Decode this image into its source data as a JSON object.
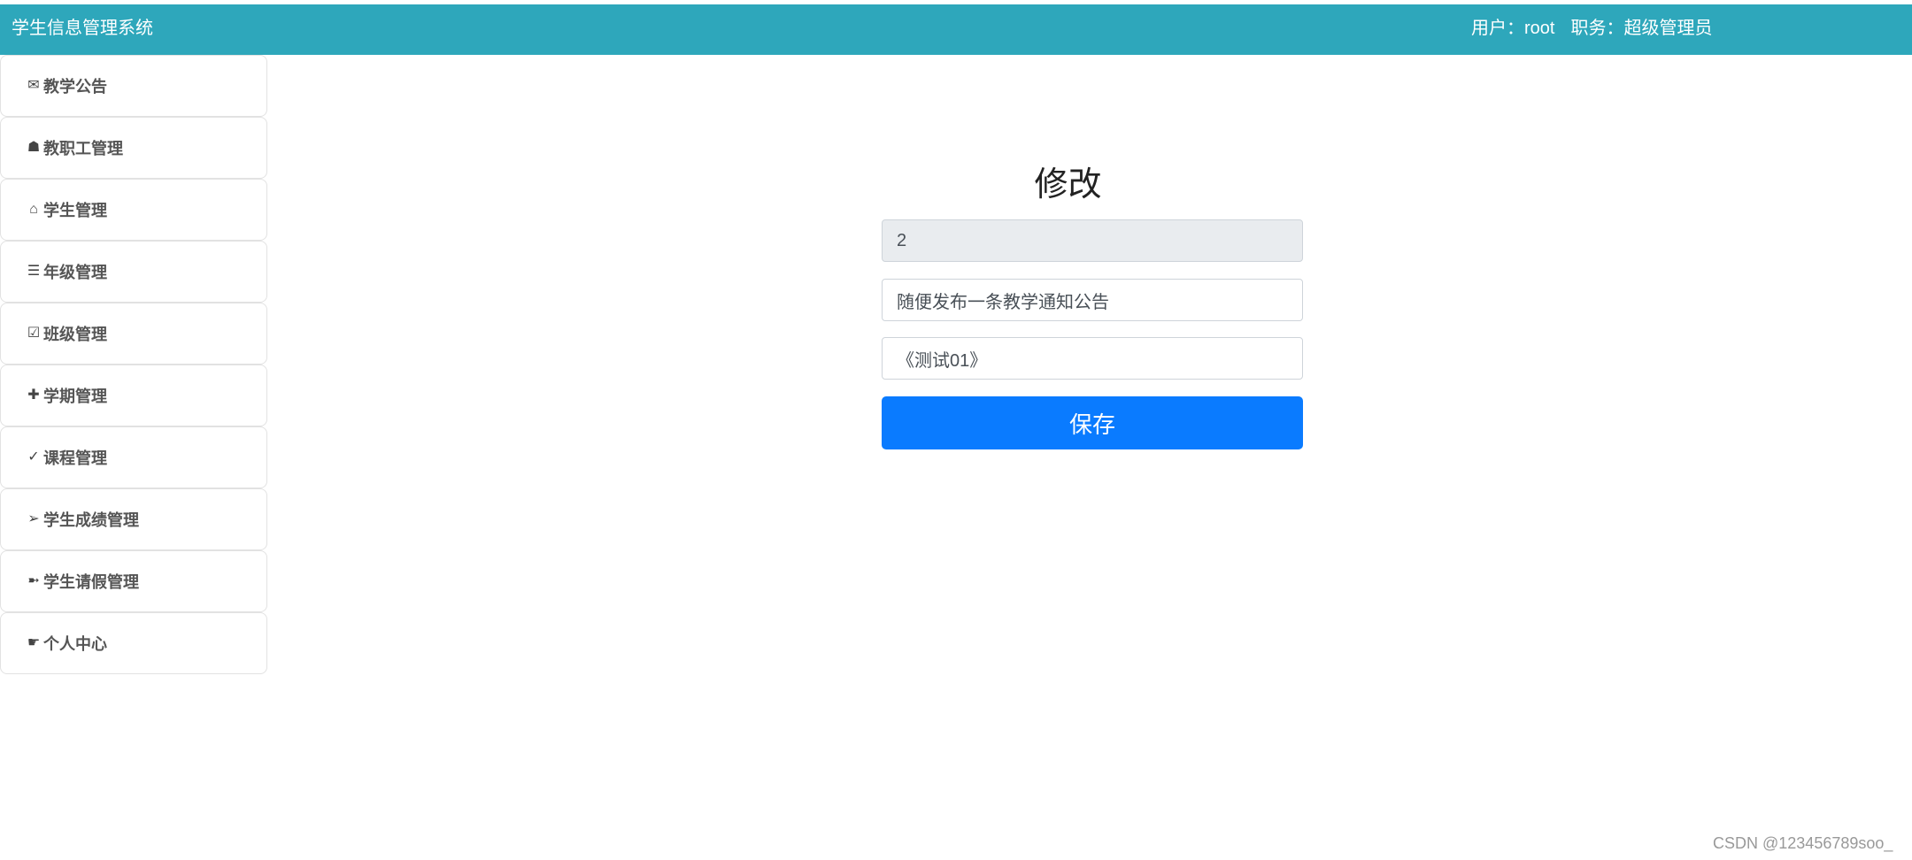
{
  "header": {
    "app_title": "学生信息管理系统",
    "user_label": "用户：",
    "user_value": "root",
    "role_label": "职务：",
    "role_value": "超级管理员"
  },
  "sidebar": {
    "items": [
      {
        "label": "教学公告",
        "icon": "envelope-icon",
        "glyph": "✉"
      },
      {
        "label": "教职工管理",
        "icon": "bell-icon",
        "glyph": "☗"
      },
      {
        "label": "学生管理",
        "icon": "home-icon",
        "glyph": "⌂"
      },
      {
        "label": "年级管理",
        "icon": "list-icon",
        "glyph": "☰"
      },
      {
        "label": "班级管理",
        "icon": "checkbox-icon",
        "glyph": "☑"
      },
      {
        "label": "学期管理",
        "icon": "plus-icon",
        "glyph": "✚"
      },
      {
        "label": "课程管理",
        "icon": "check-icon",
        "glyph": "✓"
      },
      {
        "label": "学生成绩管理",
        "icon": "arrow-icon",
        "glyph": "➢"
      },
      {
        "label": "学生请假管理",
        "icon": "arrow-out-icon",
        "glyph": "➼"
      },
      {
        "label": "个人中心",
        "icon": "hand-icon",
        "glyph": "☛"
      }
    ]
  },
  "form": {
    "title": "修改",
    "id_value": "2",
    "title_value": "随便发布一条教学通知公告",
    "content_value": "《测试01》",
    "save_label": "保存"
  },
  "watermark": "CSDN @123456789soo_"
}
